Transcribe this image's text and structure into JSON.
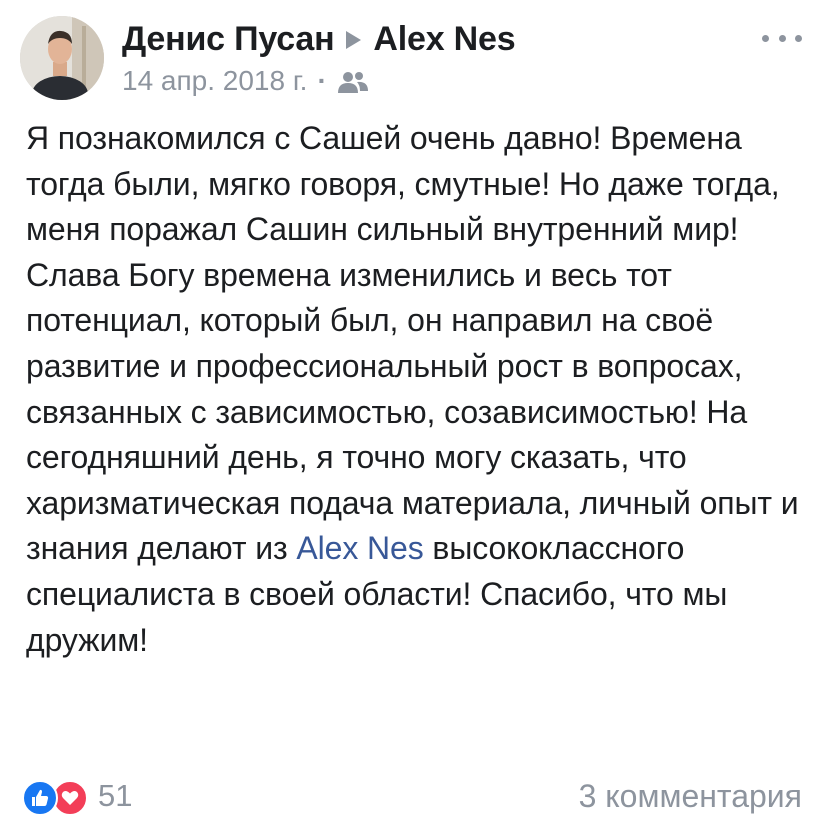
{
  "post": {
    "author": "Денис Пусан",
    "target": "Alex Nes",
    "date": "14 апр. 2018 г.",
    "meta_separator": "·",
    "privacy_icon": "friends-icon",
    "more_icon": "more-horizontal-icon",
    "text_before_mention": "Я познакомился с Сашей очень давно! Времена тогда были, мягко говоря, смутные! Но даже тогда, меня поражал Сашин сильный внутренний мир! Слава Богу времена изменились и весь тот потенциал, который был, он направил на своё развитие и профессиональный рост в вопросах, связанных с зависимостью, созависимостью! На сегодняшний день, я точно могу сказать, что харизматическая подача материала, личный опыт и знания делают из",
    "mention": "Alex Nes",
    "text_after_mention": "высококлассного специалиста в своей области! Спасибо, что мы дружим!"
  },
  "footer": {
    "reaction_icons": [
      "like-icon",
      "love-icon"
    ],
    "reaction_count": "51",
    "comments_label": "3 комментария"
  },
  "colors": {
    "text": "#1c1e21",
    "secondary": "#8d949e",
    "link": "#385898",
    "like": "#1877f2",
    "love": "#f33e58"
  }
}
